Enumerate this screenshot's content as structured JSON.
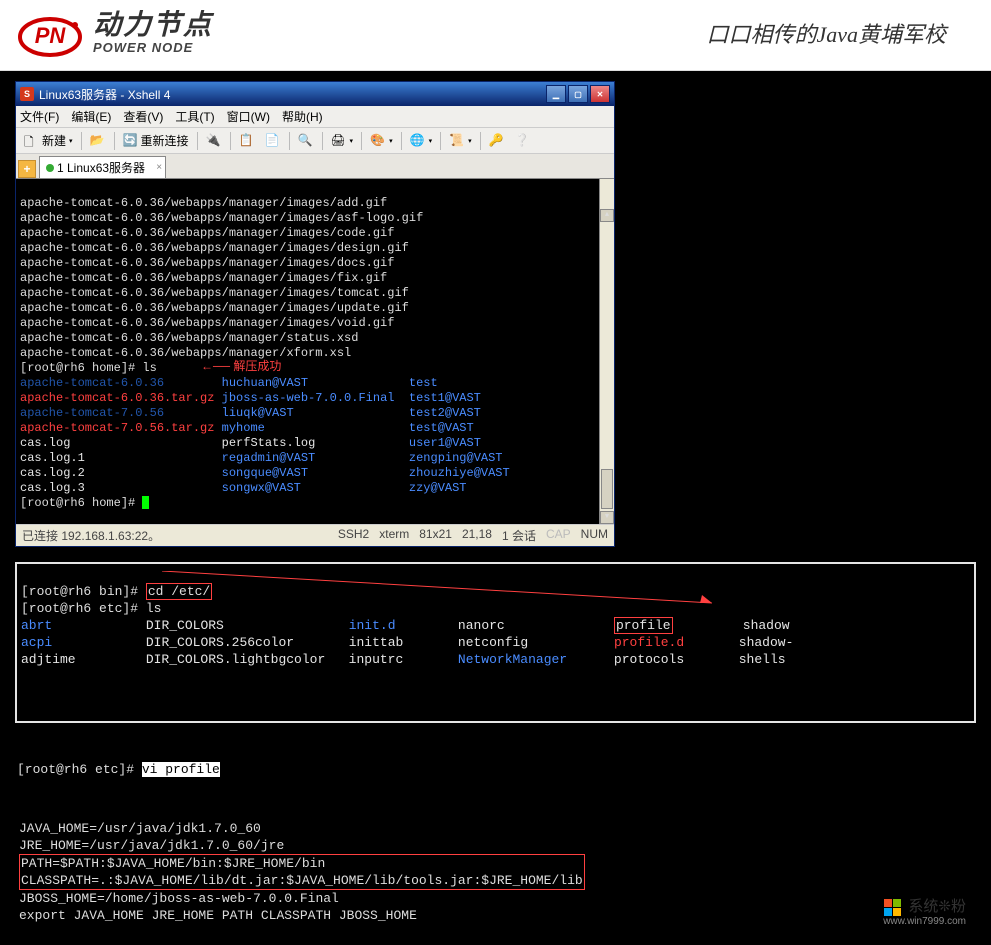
{
  "header": {
    "logo_cn": "动力节点",
    "logo_en": "POWER NODE",
    "slogan": "口口相传的Java黄埔军校"
  },
  "xshell": {
    "title": "Linux63服务器 - Xshell 4",
    "menus": [
      "文件(F)",
      "编辑(E)",
      "查看(V)",
      "工具(T)",
      "窗口(W)",
      "帮助(H)"
    ],
    "toolbar": {
      "new": "新建",
      "reconnect": "重新连接"
    },
    "tab": {
      "label": "1 Linux63服务器"
    },
    "output_lines": [
      "apache-tomcat-6.0.36/webapps/manager/images/add.gif",
      "apache-tomcat-6.0.36/webapps/manager/images/asf-logo.gif",
      "apache-tomcat-6.0.36/webapps/manager/images/code.gif",
      "apache-tomcat-6.0.36/webapps/manager/images/design.gif",
      "apache-tomcat-6.0.36/webapps/manager/images/docs.gif",
      "apache-tomcat-6.0.36/webapps/manager/images/fix.gif",
      "apache-tomcat-6.0.36/webapps/manager/images/tomcat.gif",
      "apache-tomcat-6.0.36/webapps/manager/images/update.gif",
      "apache-tomcat-6.0.36/webapps/manager/images/void.gif",
      "apache-tomcat-6.0.36/webapps/manager/status.xsd",
      "apache-tomcat-6.0.36/webapps/manager/xform.xsl"
    ],
    "prompt_ls": "[root@rh6 home]# ls",
    "annotation": "解压成功",
    "ls_listing": [
      {
        "c1": {
          "t": "apache-tomcat-6.0.36",
          "cls": "darkblue"
        },
        "c2": {
          "t": "huchuan@VAST",
          "cls": "blue"
        },
        "c3": {
          "t": "test",
          "cls": "blue"
        }
      },
      {
        "c1": {
          "t": "apache-tomcat-6.0.36.tar.gz",
          "cls": "red"
        },
        "c2": {
          "t": "jboss-as-web-7.0.0.Final",
          "cls": "blue"
        },
        "c3": {
          "t": "test1@VAST",
          "cls": "blue"
        }
      },
      {
        "c1": {
          "t": "apache-tomcat-7.0.56",
          "cls": "darkblue"
        },
        "c2": {
          "t": "liuqk@VAST",
          "cls": "blue"
        },
        "c3": {
          "t": "test2@VAST",
          "cls": "blue"
        }
      },
      {
        "c1": {
          "t": "apache-tomcat-7.0.56.tar.gz",
          "cls": "red"
        },
        "c2": {
          "t": "myhome",
          "cls": "blue"
        },
        "c3": {
          "t": "test@VAST",
          "cls": "blue"
        }
      },
      {
        "c1": {
          "t": "cas.log",
          "cls": "white"
        },
        "c2": {
          "t": "perfStats.log",
          "cls": "white"
        },
        "c3": {
          "t": "user1@VAST",
          "cls": "blue"
        }
      },
      {
        "c1": {
          "t": "cas.log.1",
          "cls": "white"
        },
        "c2": {
          "t": "regadmin@VAST",
          "cls": "blue"
        },
        "c3": {
          "t": "zengping@VAST",
          "cls": "blue"
        }
      },
      {
        "c1": {
          "t": "cas.log.2",
          "cls": "white"
        },
        "c2": {
          "t": "songque@VAST",
          "cls": "blue"
        },
        "c3": {
          "t": "zhouzhiye@VAST",
          "cls": "blue"
        }
      },
      {
        "c1": {
          "t": "cas.log.3",
          "cls": "white"
        },
        "c2": {
          "t": "songwx@VAST",
          "cls": "blue"
        },
        "c3": {
          "t": "zzy@VAST",
          "cls": "blue"
        }
      }
    ],
    "prompt_end": "[root@rh6 home]# ",
    "status": {
      "left": "已连接 192.168.1.63:22。",
      "ssh": "SSH2",
      "xterm": "xterm",
      "size": "81x21",
      "pos": "21,18",
      "sess": "1 会话",
      "cap": "CAP",
      "num": "NUM"
    }
  },
  "etc_block": {
    "prompt_cd": "[root@rh6 bin]# ",
    "cmd_cd": "cd /etc/",
    "prompt_ls": "[root@rh6 etc]# ls",
    "rows": [
      {
        "c1": {
          "t": "abrt",
          "cls": "blue"
        },
        "c2": "DIR_COLORS",
        "c3": {
          "t": "init.d",
          "cls": "blue"
        },
        "c4": "nanorc",
        "c5": {
          "t": "profile",
          "box": true
        },
        "c6": "shadow"
      },
      {
        "c1": {
          "t": "acpi",
          "cls": "blue"
        },
        "c2": "DIR_COLORS.256color",
        "c3": "inittab",
        "c4": "netconfig",
        "c5": {
          "t": "profile.d",
          "cls": "red"
        },
        "c6": "shadow-"
      },
      {
        "c1": "adjtime",
        "c2": "DIR_COLORS.lightbgcolor",
        "c3": "inputrc",
        "c4": {
          "t": "NetworkManager",
          "cls": "blue"
        },
        "c5": "protocols",
        "c6": "shells"
      }
    ]
  },
  "vi_cmd": {
    "prompt": "[root@rh6 etc]# ",
    "cmd": "vi profile"
  },
  "profile": {
    "lines": [
      "JAVA_HOME=/usr/java/jdk1.7.0_60",
      "JRE_HOME=/usr/java/jdk1.7.0_60/jre",
      "PATH=$PATH:$JAVA_HOME/bin:$JRE_HOME/bin",
      "CLASSPATH=.:$JAVA_HOME/lib/dt.jar:$JAVA_HOME/lib/tools.jar:$JRE_HOME/lib",
      "JBOSS_HOME=/home/jboss-as-web-7.0.0.Final",
      "export JAVA_HOME JRE_HOME PATH CLASSPATH JBOSS_HOME"
    ]
  },
  "footer": {
    "title": "系统❊粉",
    "sub": "www.win7999.com"
  }
}
